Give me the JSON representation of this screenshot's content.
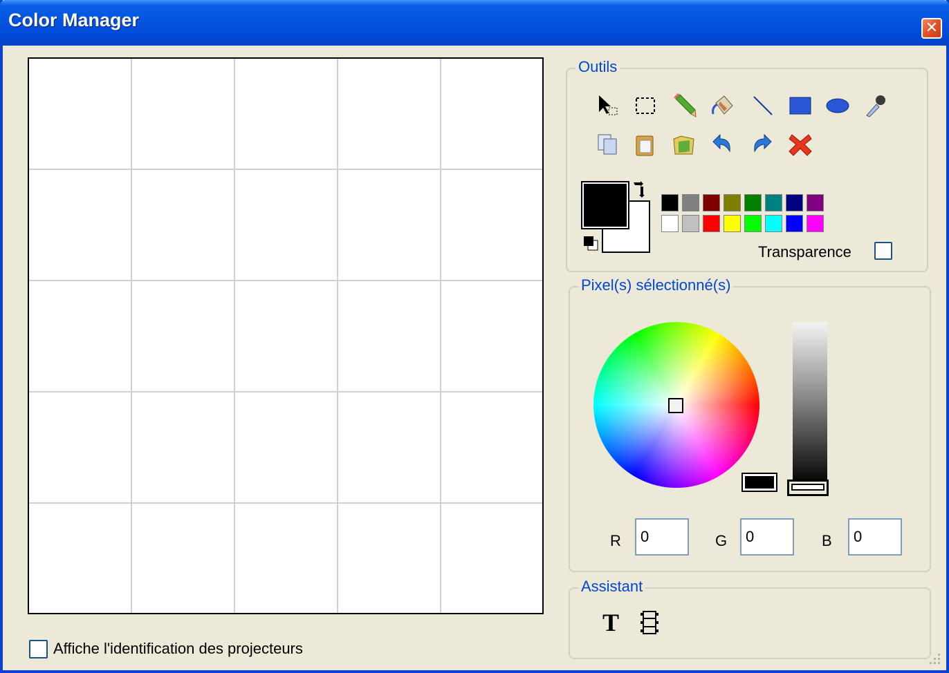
{
  "window": {
    "title": "Color Manager",
    "close_symbol": "✕"
  },
  "grid": {
    "columns": 5,
    "rows": 5
  },
  "options": {
    "show_projector_ids_label": "Affiche l'identification des projecteurs",
    "show_projector_ids_checked": false
  },
  "tools": {
    "legend": "Outils",
    "row1": [
      "select-pointer-icon",
      "rect-select-icon",
      "pencil-icon",
      "fill-bucket-icon",
      "line-icon",
      "rectangle-icon",
      "ellipse-icon",
      "eyedropper-icon"
    ],
    "row2": [
      "copy-icon",
      "paste-icon",
      "open-icon",
      "undo-icon",
      "redo-icon",
      "delete-icon"
    ],
    "foreground_color": "#000000",
    "background_color": "#ffffff",
    "palette_top": [
      "#000000",
      "#808080",
      "#800000",
      "#808000",
      "#008000",
      "#008080",
      "#000080",
      "#800080"
    ],
    "palette_bottom": [
      "#ffffff",
      "#c0c0c0",
      "#ff0000",
      "#ffff00",
      "#00ff00",
      "#00ffff",
      "#0000ff",
      "#ff00ff"
    ],
    "transparency_label": "Transparence"
  },
  "selection": {
    "legend": "Pixel(s) sélectionné(s)",
    "r_label": "R",
    "g_label": "G",
    "b_label": "B",
    "r_value": "0",
    "g_value": "0",
    "b_value": "0"
  },
  "assistant": {
    "legend": "Assistant",
    "text_tool_glyph": "T",
    "icons": [
      "text-tool-icon",
      "film-icon"
    ]
  },
  "colors": {
    "title_blue": "#0a5ee6",
    "legend_blue": "#0046d5",
    "face": "#ece9d8"
  }
}
